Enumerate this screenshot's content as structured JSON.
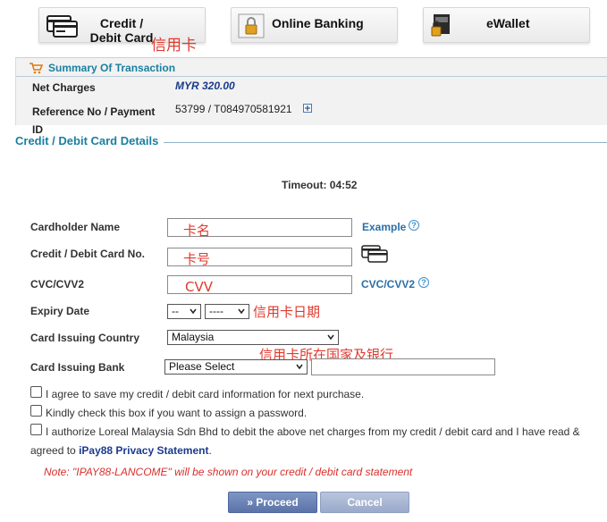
{
  "payment_methods": {
    "card": "Credit / Debit Card",
    "bank": "Online Banking",
    "wallet": "eWallet"
  },
  "annotations": {
    "credit_card": "信用卡",
    "card_name": "卡名",
    "card_number": "卡号",
    "cvv": "CVV",
    "expiry": "信用卡日期",
    "issuing": "信用卡所在国家及银行"
  },
  "summary": {
    "title": "Summary Of Transaction",
    "net_charges_label": "Net Charges",
    "net_charges_value": "MYR 320.00",
    "reference_label": "Reference No / Payment ID",
    "reference_value": "53799 / T084970581921"
  },
  "details": {
    "legend": "Credit / Debit Card Details",
    "timeout": "Timeout: 04:52"
  },
  "form": {
    "cardholder_label": "Cardholder Name",
    "example_link": "Example",
    "card_no_label": "Credit / Debit Card No.",
    "cvc_label": "CVC/CVV2",
    "cvc_link": "CVC/CVV2",
    "expiry_label": "Expiry Date",
    "expiry_month": "--",
    "expiry_year": "----",
    "country_label": "Card Issuing Country",
    "country_value": "Malaysia",
    "bank_label": "Card Issuing Bank",
    "bank_value": "Please Select"
  },
  "checkboxes": {
    "save_card": "I agree to save my credit / debit card information for next purchase.",
    "assign_password": "Kindly check this box if you want to assign a password.",
    "authorize_part1": "I authorize Loreal Malaysia Sdn Bhd to debit the above net charges from my credit / debit card and I have read &",
    "authorize_part2": "agreed to",
    "privacy_link": "iPay88 Privacy Statement",
    "period": "."
  },
  "note": "Note: \"IPAY88-LANCOME\" will be shown on your credit / debit card statement",
  "actions": {
    "proceed": "» Proceed",
    "cancel": "Cancel"
  }
}
